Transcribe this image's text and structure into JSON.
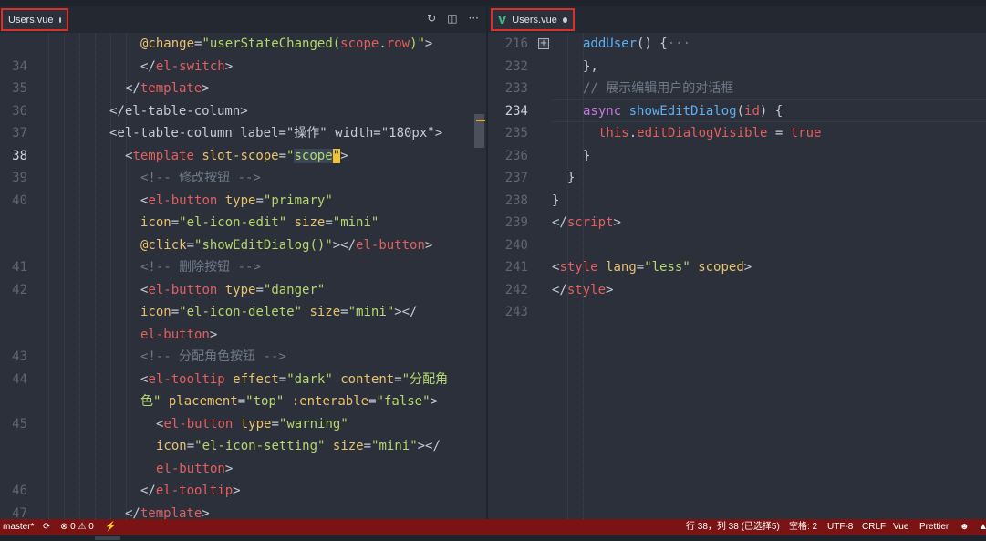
{
  "left_tab": {
    "filename": "Users.vue"
  },
  "right_tab": {
    "filename": "Users.vue",
    "icon": "V"
  },
  "tab_actions": [
    "↻",
    "◫",
    "···"
  ],
  "left_editor": {
    "current_line": "38",
    "lines": [
      {
        "n": "",
        "indent": 154,
        "tokens": [
          {
            "c": "t-attr",
            "t": "@change"
          },
          {
            "c": "t-plain",
            "t": "="
          },
          {
            "c": "t-str",
            "t": "\"userStateChanged("
          },
          {
            "c": "t-tag",
            "t": "scope"
          },
          {
            "c": "t-plain",
            "t": "."
          },
          {
            "c": "t-tag",
            "t": "row"
          },
          {
            "c": "t-str",
            "t": ")\""
          },
          {
            "c": "t-plain",
            "t": ">"
          }
        ]
      },
      {
        "n": "34",
        "indent": 154,
        "tokens": [
          {
            "c": "t-plain",
            "t": "</"
          },
          {
            "c": "t-tag",
            "t": "el-switch"
          },
          {
            "c": "t-plain",
            "t": ">"
          }
        ]
      },
      {
        "n": "35",
        "indent": 137,
        "tokens": [
          {
            "c": "t-plain",
            "t": "</"
          },
          {
            "c": "t-tag",
            "t": "template"
          },
          {
            "c": "t-plain",
            "t": ">"
          }
        ]
      },
      {
        "n": "36",
        "indent": 120,
        "tokens": [
          {
            "c": "t-plain",
            "t": "</el-table-column>"
          }
        ]
      },
      {
        "n": "37",
        "indent": 120,
        "tokens": [
          {
            "c": "t-plain",
            "t": "<el-table-column label=\"操作\" width=\"180px\">"
          }
        ]
      },
      {
        "n": "38",
        "indent": 137,
        "tokens": [
          {
            "c": "t-plain",
            "t": "<"
          },
          {
            "c": "t-tag",
            "t": "template"
          },
          {
            "c": "t-plain",
            "t": " "
          },
          {
            "c": "t-attr",
            "t": "slot-scope"
          },
          {
            "c": "t-plain",
            "t": "="
          },
          {
            "c": "t-str",
            "t": "\""
          },
          {
            "c": "t-str t-sel",
            "t": "scope"
          },
          {
            "c": "t-hl",
            "t": "\""
          },
          {
            "c": "t-plain",
            "t": ">"
          }
        ]
      },
      {
        "n": "39",
        "indent": 154,
        "tokens": [
          {
            "c": "t-cmt",
            "t": "<!-- 修改按钮 -->"
          }
        ]
      },
      {
        "n": "40",
        "indent": 154,
        "tokens": [
          {
            "c": "t-plain",
            "t": "<"
          },
          {
            "c": "t-tag",
            "t": "el-button"
          },
          {
            "c": "t-plain",
            "t": " "
          },
          {
            "c": "t-attr",
            "t": "type"
          },
          {
            "c": "t-plain",
            "t": "="
          },
          {
            "c": "t-str",
            "t": "\"primary\""
          }
        ]
      },
      {
        "n": "",
        "indent": 154,
        "tokens": [
          {
            "c": "t-attr",
            "t": "icon"
          },
          {
            "c": "t-plain",
            "t": "="
          },
          {
            "c": "t-str",
            "t": "\"el-icon-edit\""
          },
          {
            "c": "t-plain",
            "t": " "
          },
          {
            "c": "t-attr",
            "t": "size"
          },
          {
            "c": "t-plain",
            "t": "="
          },
          {
            "c": "t-str",
            "t": "\"mini\""
          }
        ]
      },
      {
        "n": "",
        "indent": 154,
        "tokens": [
          {
            "c": "t-attr",
            "t": "@click"
          },
          {
            "c": "t-plain",
            "t": "="
          },
          {
            "c": "t-str",
            "t": "\"showEditDialog()\""
          },
          {
            "c": "t-plain",
            "t": "></"
          },
          {
            "c": "t-tag",
            "t": "el-button"
          },
          {
            "c": "t-plain",
            "t": ">"
          }
        ]
      },
      {
        "n": "41",
        "indent": 154,
        "tokens": [
          {
            "c": "t-cmt",
            "t": "<!-- 删除按钮 -->"
          }
        ]
      },
      {
        "n": "42",
        "indent": 154,
        "tokens": [
          {
            "c": "t-plain",
            "t": "<"
          },
          {
            "c": "t-tag",
            "t": "el-button"
          },
          {
            "c": "t-plain",
            "t": " "
          },
          {
            "c": "t-attr",
            "t": "type"
          },
          {
            "c": "t-plain",
            "t": "="
          },
          {
            "c": "t-str",
            "t": "\"danger\""
          }
        ]
      },
      {
        "n": "",
        "indent": 154,
        "tokens": [
          {
            "c": "t-attr",
            "t": "icon"
          },
          {
            "c": "t-plain",
            "t": "="
          },
          {
            "c": "t-str",
            "t": "\"el-icon-delete\""
          },
          {
            "c": "t-plain",
            "t": " "
          },
          {
            "c": "t-attr",
            "t": "size"
          },
          {
            "c": "t-plain",
            "t": "="
          },
          {
            "c": "t-str",
            "t": "\"mini\""
          },
          {
            "c": "t-plain",
            "t": "></"
          }
        ]
      },
      {
        "n": "",
        "indent": 154,
        "tokens": [
          {
            "c": "t-tag",
            "t": "el-button"
          },
          {
            "c": "t-plain",
            "t": ">"
          }
        ]
      },
      {
        "n": "43",
        "indent": 154,
        "tokens": [
          {
            "c": "t-cmt",
            "t": "<!-- 分配角色按钮 -->"
          }
        ]
      },
      {
        "n": "44",
        "indent": 154,
        "tokens": [
          {
            "c": "t-plain",
            "t": "<"
          },
          {
            "c": "t-tag",
            "t": "el-tooltip"
          },
          {
            "c": "t-plain",
            "t": " "
          },
          {
            "c": "t-attr",
            "t": "effect"
          },
          {
            "c": "t-plain",
            "t": "="
          },
          {
            "c": "t-str",
            "t": "\"dark\""
          },
          {
            "c": "t-plain",
            "t": " "
          },
          {
            "c": "t-attr",
            "t": "content"
          },
          {
            "c": "t-plain",
            "t": "="
          },
          {
            "c": "t-str",
            "t": "\"分配角"
          }
        ]
      },
      {
        "n": "",
        "indent": 154,
        "tokens": [
          {
            "c": "t-str",
            "t": "色\""
          },
          {
            "c": "t-plain",
            "t": " "
          },
          {
            "c": "t-attr",
            "t": "placement"
          },
          {
            "c": "t-plain",
            "t": "="
          },
          {
            "c": "t-str",
            "t": "\"top\""
          },
          {
            "c": "t-plain",
            "t": " "
          },
          {
            "c": "t-attr",
            "t": ":enterable"
          },
          {
            "c": "t-plain",
            "t": "="
          },
          {
            "c": "t-str",
            "t": "\"false\""
          },
          {
            "c": "t-plain",
            "t": ">"
          }
        ]
      },
      {
        "n": "45",
        "indent": 171,
        "tokens": [
          {
            "c": "t-plain",
            "t": "<"
          },
          {
            "c": "t-tag",
            "t": "el-button"
          },
          {
            "c": "t-plain",
            "t": " "
          },
          {
            "c": "t-attr",
            "t": "type"
          },
          {
            "c": "t-plain",
            "t": "="
          },
          {
            "c": "t-str",
            "t": "\"warning\""
          }
        ]
      },
      {
        "n": "",
        "indent": 171,
        "tokens": [
          {
            "c": "t-attr",
            "t": "icon"
          },
          {
            "c": "t-plain",
            "t": "="
          },
          {
            "c": "t-str",
            "t": "\"el-icon-setting\""
          },
          {
            "c": "t-plain",
            "t": " "
          },
          {
            "c": "t-attr",
            "t": "size"
          },
          {
            "c": "t-plain",
            "t": "="
          },
          {
            "c": "t-str",
            "t": "\"mini\""
          },
          {
            "c": "t-plain",
            "t": "></"
          }
        ]
      },
      {
        "n": "",
        "indent": 171,
        "tokens": [
          {
            "c": "t-tag",
            "t": "el-button"
          },
          {
            "c": "t-plain",
            "t": ">"
          }
        ]
      },
      {
        "n": "46",
        "indent": 154,
        "tokens": [
          {
            "c": "t-plain",
            "t": "</"
          },
          {
            "c": "t-tag",
            "t": "el-tooltip"
          },
          {
            "c": "t-plain",
            "t": ">"
          }
        ]
      },
      {
        "n": "47",
        "indent": 137,
        "tokens": [
          {
            "c": "t-plain",
            "t": "</"
          },
          {
            "c": "t-tag",
            "t": "template"
          },
          {
            "c": "t-plain",
            "t": ">"
          }
        ]
      }
    ]
  },
  "right_editor": {
    "current_line": "234",
    "lines": [
      {
        "n": "216",
        "indent": 104,
        "fold": "+",
        "tokens": [
          {
            "c": "t-fn",
            "t": "addUser"
          },
          {
            "c": "t-plain",
            "t": "() {"
          },
          {
            "c": "t-cmt",
            "t": "···"
          }
        ]
      },
      {
        "n": "232",
        "indent": 104,
        "tokens": [
          {
            "c": "t-plain",
            "t": "},"
          }
        ]
      },
      {
        "n": "233",
        "indent": 104,
        "tokens": [
          {
            "c": "t-cmt",
            "t": "// 展示编辑用户的对话框"
          }
        ]
      },
      {
        "n": "234",
        "indent": 104,
        "tokens": [
          {
            "c": "t-kw",
            "t": "async"
          },
          {
            "c": "t-plain",
            "t": " "
          },
          {
            "c": "t-fn",
            "t": "showEditDialog"
          },
          {
            "c": "t-plain",
            "t": "("
          },
          {
            "c": "t-tag",
            "t": "id"
          },
          {
            "c": "t-plain",
            "t": ") {"
          }
        ]
      },
      {
        "n": "235",
        "indent": 121,
        "tokens": [
          {
            "c": "t-tag",
            "t": "this"
          },
          {
            "c": "t-plain",
            "t": "."
          },
          {
            "c": "t-tag",
            "t": "editDialogVisible"
          },
          {
            "c": "t-plain",
            "t": " = "
          },
          {
            "c": "t-tag",
            "t": "true"
          }
        ]
      },
      {
        "n": "236",
        "indent": 104,
        "tokens": [
          {
            "c": "t-plain",
            "t": "}"
          }
        ]
      },
      {
        "n": "237",
        "indent": 87,
        "tokens": [
          {
            "c": "t-plain",
            "t": "}"
          }
        ]
      },
      {
        "n": "238",
        "indent": 70,
        "tokens": [
          {
            "c": "t-plain",
            "t": "}"
          }
        ]
      },
      {
        "n": "239",
        "indent": 70,
        "tokens": [
          {
            "c": "t-plain",
            "t": "</"
          },
          {
            "c": "t-tag",
            "t": "script"
          },
          {
            "c": "t-plain",
            "t": ">"
          }
        ]
      },
      {
        "n": "240",
        "indent": 70,
        "tokens": []
      },
      {
        "n": "241",
        "indent": 70,
        "tokens": [
          {
            "c": "t-plain",
            "t": "<"
          },
          {
            "c": "t-tag",
            "t": "style"
          },
          {
            "c": "t-plain",
            "t": " "
          },
          {
            "c": "t-attr",
            "t": "lang"
          },
          {
            "c": "t-plain",
            "t": "="
          },
          {
            "c": "t-str",
            "t": "\"less\""
          },
          {
            "c": "t-plain",
            "t": " "
          },
          {
            "c": "t-attr",
            "t": "scoped"
          },
          {
            "c": "t-plain",
            "t": ">"
          }
        ]
      },
      {
        "n": "242",
        "indent": 70,
        "tokens": [
          {
            "c": "t-plain",
            "t": "</"
          },
          {
            "c": "t-tag",
            "t": "style"
          },
          {
            "c": "t-plain",
            "t": ">"
          }
        ]
      },
      {
        "n": "243",
        "indent": 70,
        "tokens": []
      }
    ]
  },
  "status": {
    "branch": "master*",
    "sync": "⟳",
    "problems": "⊗ 0 ⚠ 0",
    "bolt": "⚡",
    "position": "行 38，列 38 (已选择5)",
    "spaces": "空格: 2",
    "encoding": "UTF-8",
    "eol": "CRLF",
    "language": "Vue",
    "formatter": "Prettier",
    "feedback": "☻",
    "bell": "▲"
  }
}
